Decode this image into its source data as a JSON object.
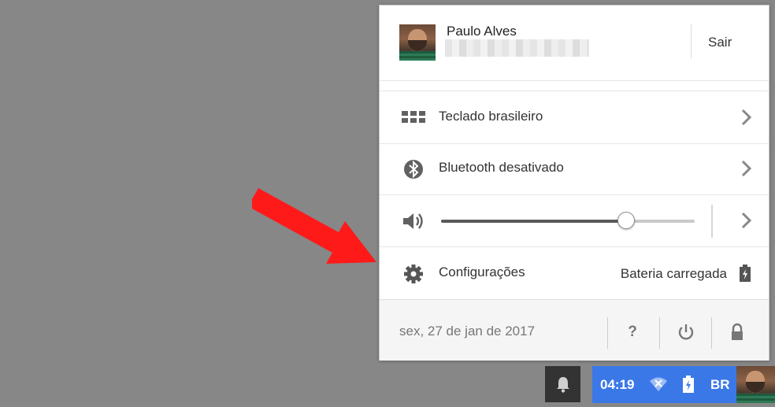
{
  "account": {
    "name": "Paulo Alves",
    "signout_label": "Sair"
  },
  "menu": {
    "keyboard_label": "Teclado brasileiro",
    "bluetooth_label": "Bluetooth desativado",
    "volume_level_percent": 73,
    "settings_label": "Configurações",
    "battery_label": "Bateria carregada"
  },
  "footer": {
    "date": "sex, 27 de jan de 2017",
    "help_symbol": "?"
  },
  "shelf": {
    "time": "04:19",
    "locale": "BR"
  },
  "colors": {
    "desktop": "#878787",
    "status_area": "#3b78e7",
    "annotation_arrow": "#ff1a1a"
  },
  "icons": [
    "keyboard-icon",
    "bluetooth-icon",
    "volume-icon",
    "gear-icon",
    "battery-icon",
    "help-icon",
    "power-icon",
    "lock-icon",
    "bell-icon",
    "wifi-icon",
    "chevron-right-icon"
  ]
}
